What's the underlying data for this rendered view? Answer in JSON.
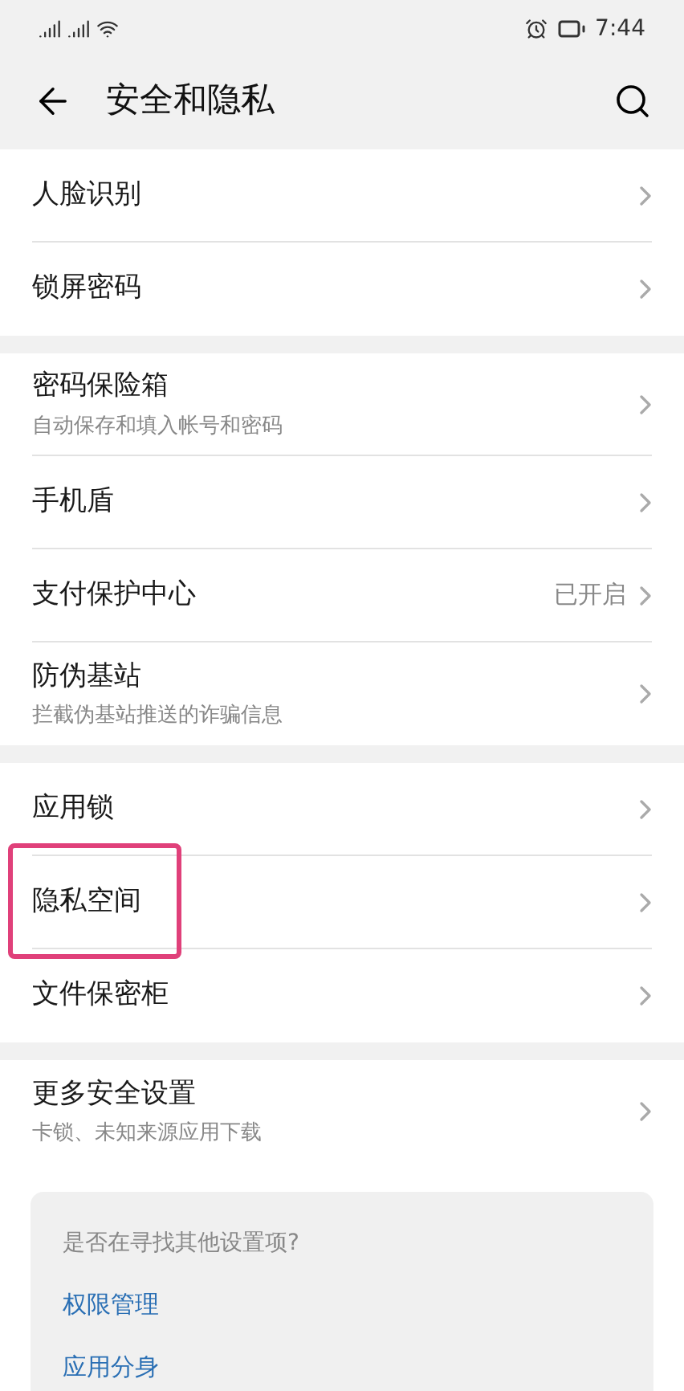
{
  "status_bar": {
    "time": "7:44"
  },
  "header": {
    "title": "安全和隐私"
  },
  "groups": [
    {
      "items": [
        {
          "title": "人脸识别",
          "highlighted": false
        },
        {
          "title": "锁屏密码",
          "highlighted": false
        }
      ]
    },
    {
      "items": [
        {
          "title": "密码保险箱",
          "subtitle": "自动保存和填入帐号和密码",
          "highlighted": false
        },
        {
          "title": "手机盾",
          "highlighted": false
        },
        {
          "title": "支付保护中心",
          "value": "已开启",
          "highlighted": false
        },
        {
          "title": "防伪基站",
          "subtitle": "拦截伪基站推送的诈骗信息",
          "highlighted": false
        }
      ]
    },
    {
      "items": [
        {
          "title": "应用锁",
          "highlighted": false
        },
        {
          "title": "隐私空间",
          "highlighted": true
        },
        {
          "title": "文件保密柜",
          "highlighted": false
        }
      ]
    },
    {
      "items": [
        {
          "title": "更多安全设置",
          "subtitle": "卡锁、未知来源应用下载",
          "highlighted": false
        }
      ]
    }
  ],
  "suggestions": {
    "prompt": "是否在寻找其他设置项?",
    "links": [
      "权限管理",
      "应用分身"
    ]
  }
}
